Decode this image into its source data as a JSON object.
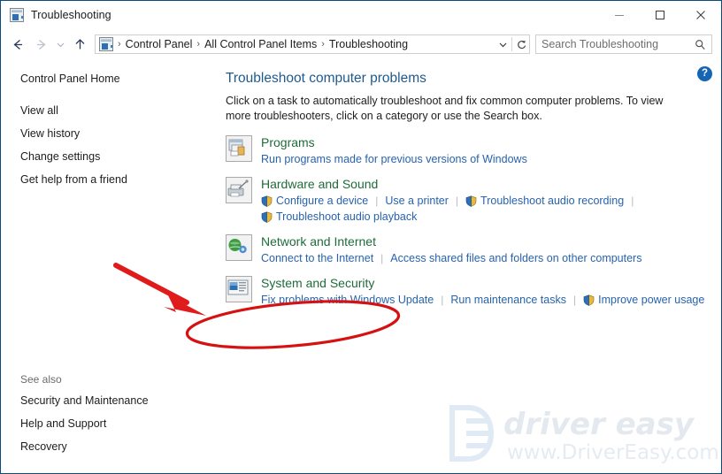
{
  "window": {
    "title": "Troubleshooting",
    "icon": "control-panel-icon",
    "minimize_label": "Minimize",
    "maximize_label": "Maximize",
    "close_label": "Close"
  },
  "nav": {
    "back_label": "Back",
    "forward_label": "Forward",
    "recent_label": "Recent locations",
    "up_label": "Up one level",
    "refresh_label": "Refresh",
    "dropdown_label": "Previous locations",
    "breadcrumbs": [
      "Control Panel",
      "All Control Panel Items",
      "Troubleshooting"
    ],
    "separator": "›"
  },
  "search": {
    "placeholder": "Search Troubleshooting",
    "value": "",
    "icon": "search-icon"
  },
  "help": {
    "label": "?"
  },
  "sidebar": {
    "home": "Control Panel Home",
    "items": [
      "View all",
      "View history",
      "Change settings",
      "Get help from a friend"
    ],
    "see_also_label": "See also",
    "see_also_items": [
      "Security and Maintenance",
      "Help and Support",
      "Recovery"
    ]
  },
  "main": {
    "title": "Troubleshoot computer problems",
    "description": "Click on a task to automatically troubleshoot and fix common computer problems. To view more troubleshooters, click on a category or use the Search box.",
    "categories": [
      {
        "name": "Programs",
        "icon": "programs-icon",
        "links": [
          {
            "label": "Run programs made for previous versions of Windows",
            "shield": false
          }
        ]
      },
      {
        "name": "Hardware and Sound",
        "icon": "hardware-sound-icon",
        "links": [
          {
            "label": "Configure a device",
            "shield": true
          },
          {
            "label": "Use a printer",
            "shield": false
          },
          {
            "label": "Troubleshoot audio recording",
            "shield": true
          },
          {
            "label": "Troubleshoot audio playback",
            "shield": true
          }
        ]
      },
      {
        "name": "Network and Internet",
        "icon": "network-internet-icon",
        "links": [
          {
            "label": "Connect to the Internet",
            "shield": false
          },
          {
            "label": "Access shared files and folders on other computers",
            "shield": false
          }
        ]
      },
      {
        "name": "System and Security",
        "icon": "system-security-icon",
        "links": [
          {
            "label": "Fix problems with Windows Update",
            "shield": false
          },
          {
            "label": "Run maintenance tasks",
            "shield": false
          },
          {
            "label": "Improve power usage",
            "shield": true
          }
        ]
      }
    ]
  },
  "annotations": {
    "color": "#e01b1b",
    "arrow_name": "red-arrow-annotation",
    "ellipse_name": "red-ellipse-annotation",
    "target": "System and Security"
  },
  "watermark": {
    "brand": "driver easy",
    "url": "www.DriverEasy.com",
    "color": "#dde7f0"
  }
}
